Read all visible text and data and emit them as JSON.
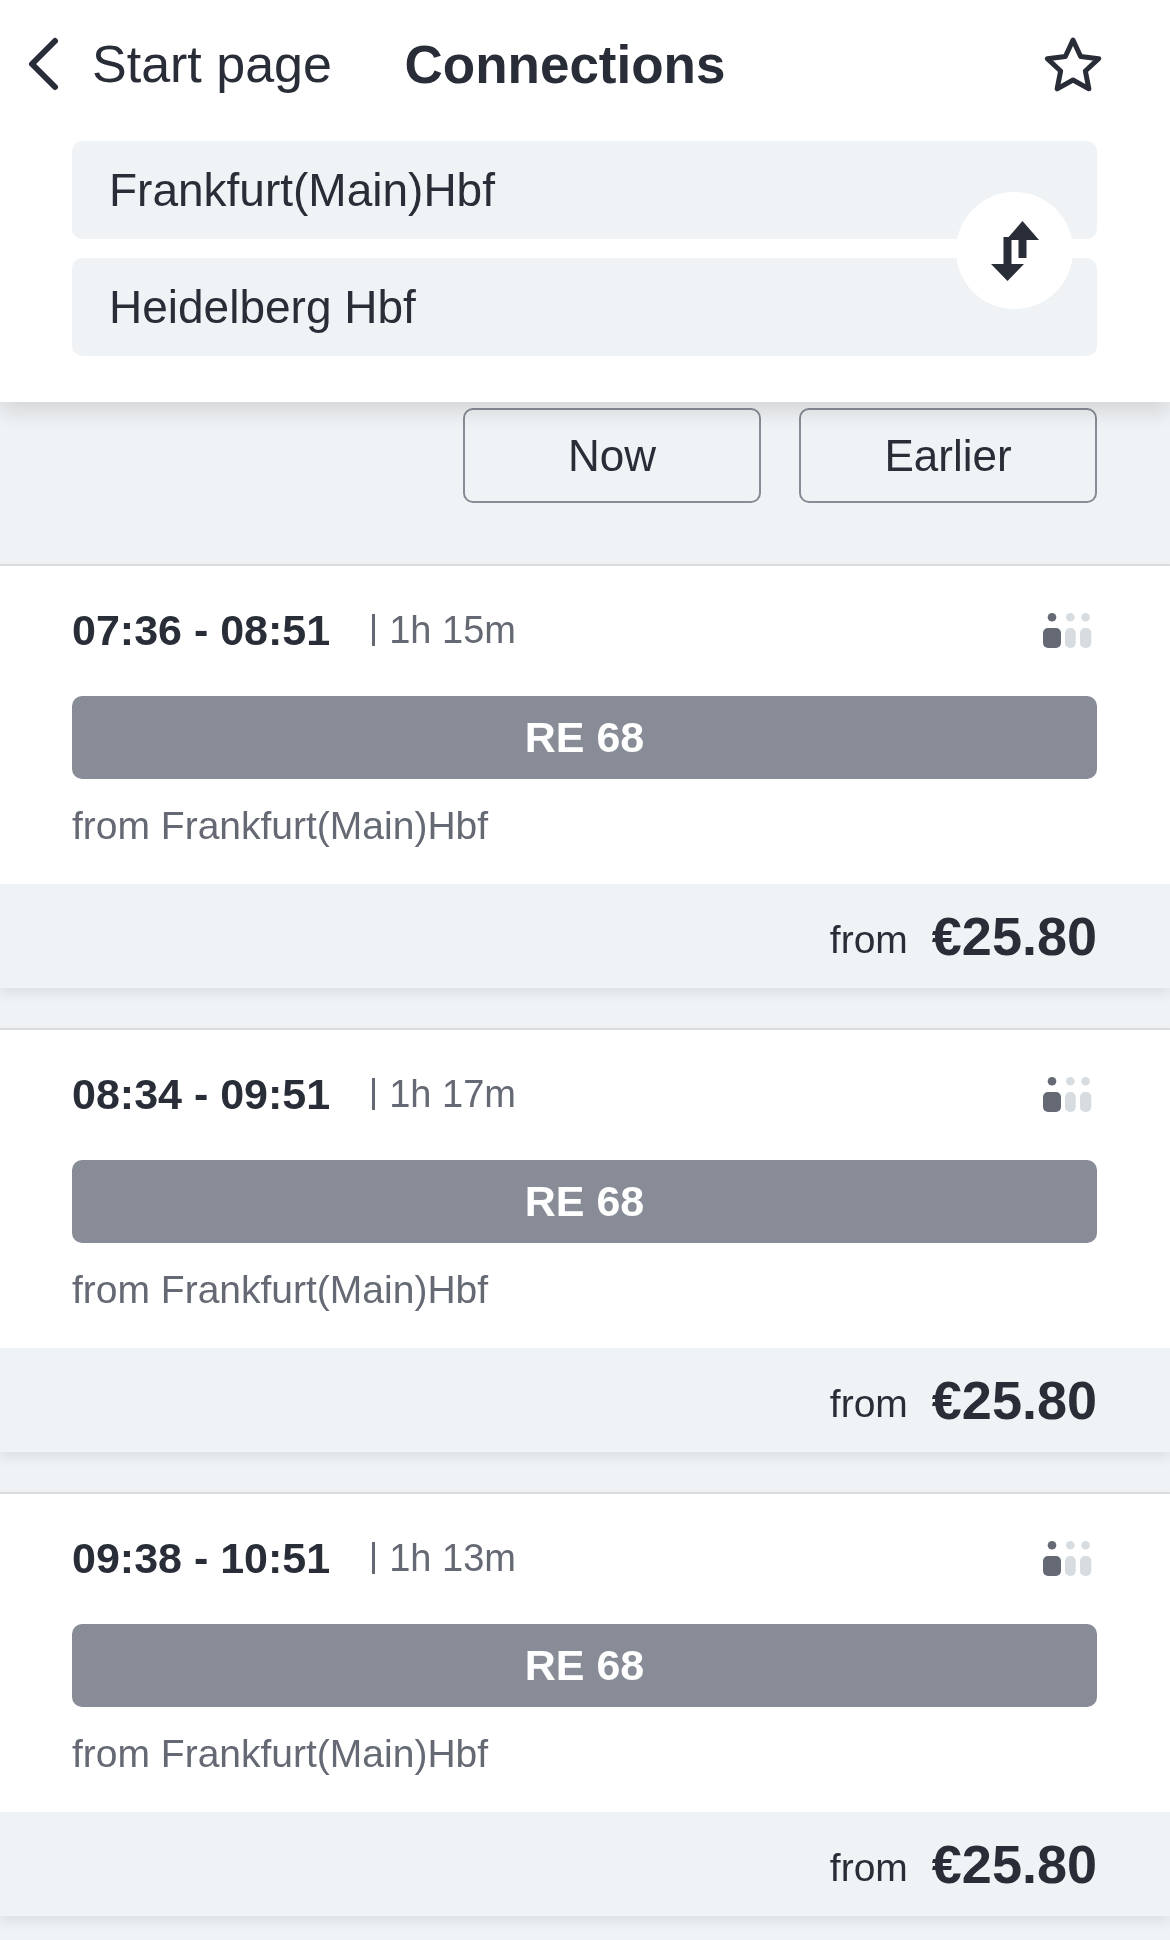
{
  "header": {
    "back_label": "Start page",
    "title": "Connections",
    "favorite": false
  },
  "route": {
    "origin": "Frankfurt(Main)Hbf",
    "destination": "Heidelberg Hbf"
  },
  "time_buttons": [
    "Now",
    "Earlier"
  ],
  "connections": [
    {
      "times": "07:36 - 08:51",
      "duration": "1h 15m",
      "occupancy": {
        "level": 0.33
      },
      "train": "RE 68",
      "departure_station": "from Frankfurt(Main)Hbf",
      "price_prefix": "from",
      "price": "€25.80"
    },
    {
      "times": "08:34 - 09:51",
      "duration": "1h 17m",
      "occupancy": {
        "level": 0.33
      },
      "train": "RE 68",
      "departure_station": "from Frankfurt(Main)Hbf",
      "price_prefix": "from",
      "price": "€25.80"
    },
    {
      "times": "09:38 - 10:51",
      "duration": "1h 13m",
      "occupancy": {
        "level": 0.33
      },
      "train": "RE 68",
      "departure_station": "from Frankfurt(Main)Hbf",
      "price_prefix": "from",
      "price": "€25.80"
    }
  ]
}
